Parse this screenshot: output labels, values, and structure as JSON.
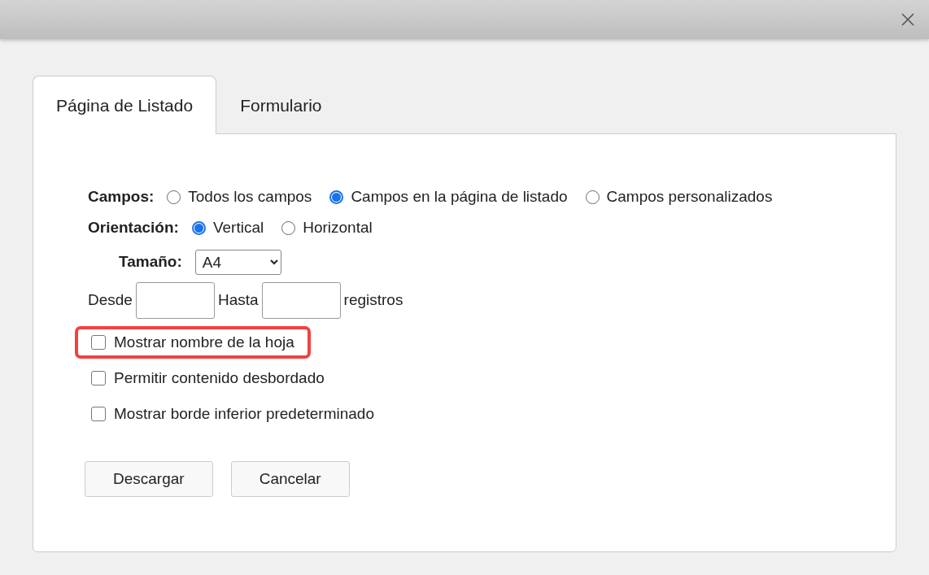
{
  "tabs": [
    {
      "label": "Página de Listado",
      "selected": true
    },
    {
      "label": "Formulario",
      "selected": false
    }
  ],
  "radio_groups": [
    {
      "label": "Campos:",
      "options": [
        {
          "label": "Todos los campos",
          "selected": false
        },
        {
          "label": "Campos en la página de listado",
          "selected": true
        },
        {
          "label": "Campos personalizados",
          "selected": false
        }
      ]
    },
    {
      "label": "Orientación:",
      "options": [
        {
          "label": "Vertical",
          "selected": true
        },
        {
          "label": "Horizontal",
          "selected": false
        }
      ]
    }
  ],
  "size": {
    "label": "Tamaño:",
    "value": "A4"
  },
  "range": {
    "from_label": "Desde",
    "to_label": "Hasta",
    "suffix": "registros"
  },
  "checkboxes": [
    {
      "label": "Mostrar nombre de la hoja",
      "checked": false,
      "highlighted": true
    },
    {
      "label": "Permitir contenido desbordado",
      "checked": false,
      "highlighted": false
    },
    {
      "label": "Mostrar borde inferior predeterminado",
      "checked": false,
      "highlighted": false
    }
  ],
  "buttons": [
    "Descargar",
    "Cancelar"
  ]
}
